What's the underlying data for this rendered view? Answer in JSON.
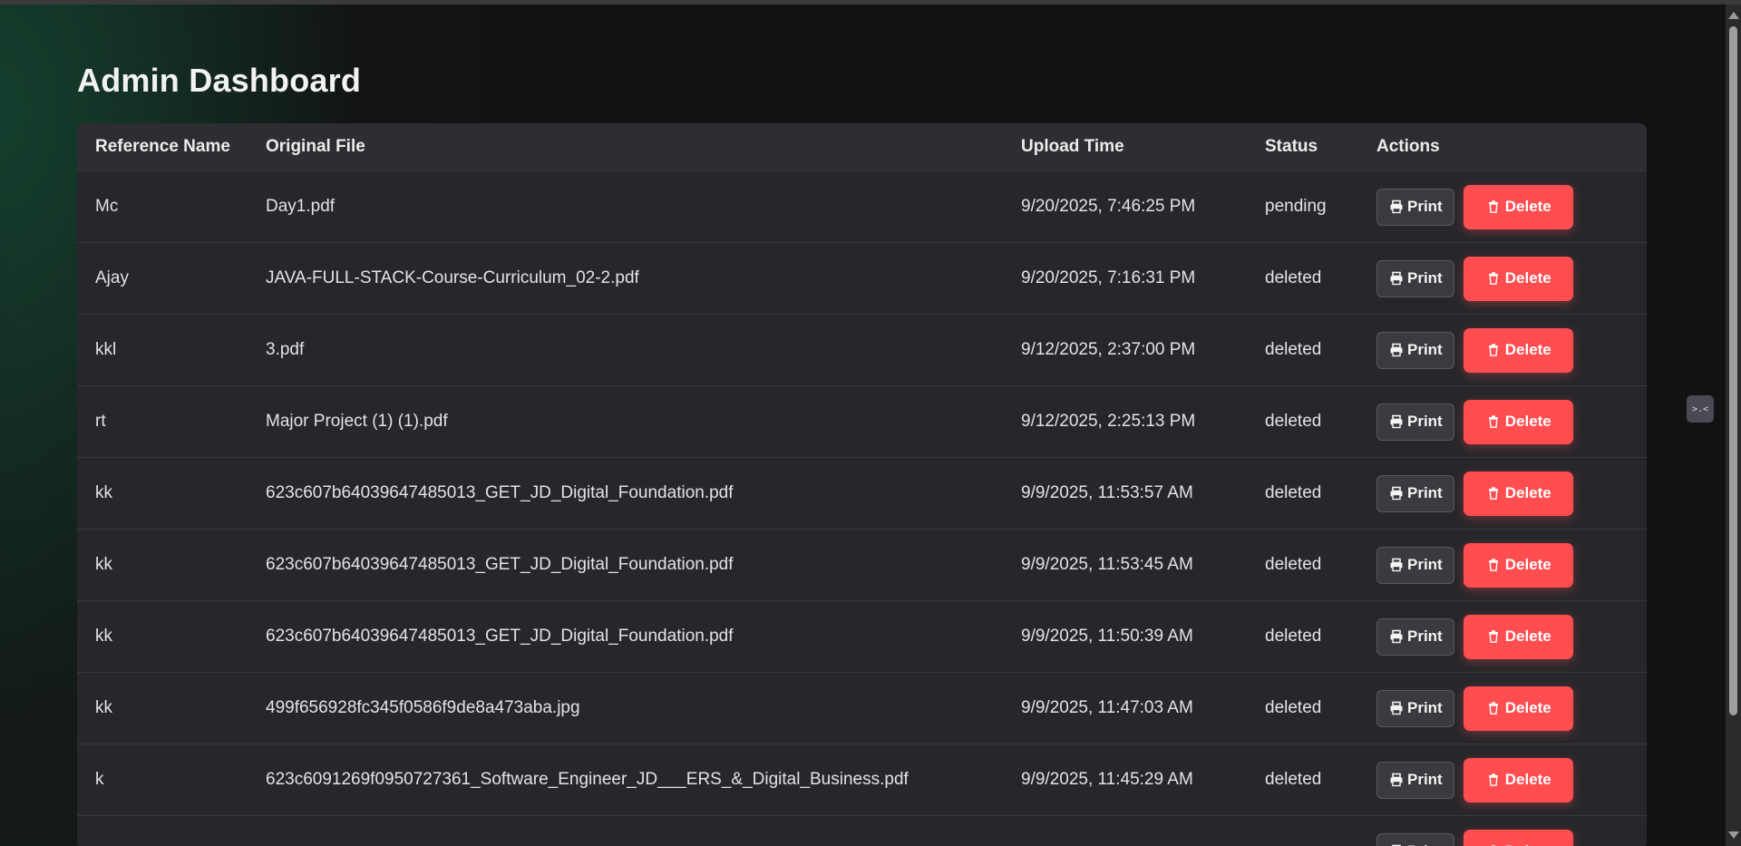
{
  "title": "Admin Dashboard",
  "columns": {
    "ref": "Reference Name",
    "file": "Original File",
    "time": "Upload Time",
    "status": "Status",
    "actions": "Actions"
  },
  "buttons": {
    "print": "Print",
    "delete": "Delete"
  },
  "rows": [
    {
      "ref": "Mc",
      "file": "Day1.pdf",
      "time": "9/20/2025, 7:46:25 PM",
      "status": "pending"
    },
    {
      "ref": "Ajay",
      "file": "JAVA-FULL-STACK-Course-Curriculum_02-2.pdf",
      "time": "9/20/2025, 7:16:31 PM",
      "status": "deleted"
    },
    {
      "ref": "kkl",
      "file": "3.pdf",
      "time": "9/12/2025, 2:37:00 PM",
      "status": "deleted"
    },
    {
      "ref": "rt",
      "file": "Major Project (1) (1).pdf",
      "time": "9/12/2025, 2:25:13 PM",
      "status": "deleted"
    },
    {
      "ref": "kk",
      "file": "623c607b64039647485013_GET_JD_Digital_Foundation.pdf",
      "time": "9/9/2025, 11:53:57 AM",
      "status": "deleted"
    },
    {
      "ref": "kk",
      "file": "623c607b64039647485013_GET_JD_Digital_Foundation.pdf",
      "time": "9/9/2025, 11:53:45 AM",
      "status": "deleted"
    },
    {
      "ref": "kk",
      "file": "623c607b64039647485013_GET_JD_Digital_Foundation.pdf",
      "time": "9/9/2025, 11:50:39 AM",
      "status": "deleted"
    },
    {
      "ref": "kk",
      "file": "499f656928fc345f0586f9de8a473aba.jpg",
      "time": "9/9/2025, 11:47:03 AM",
      "status": "deleted"
    },
    {
      "ref": "k",
      "file": "623c6091269f0950727361_Software_Engineer_JD___ERS_&_Digital_Business.pdf",
      "time": "9/9/2025, 11:45:29 AM",
      "status": "deleted"
    },
    {
      "ref": "",
      "file": "",
      "time": "",
      "status": ""
    }
  ],
  "icons": {
    "print": "printer-icon",
    "delete": "trash-icon"
  },
  "colors": {
    "delete": "#ff4d50",
    "print": "#3a3a3f",
    "card": "#27272b"
  }
}
